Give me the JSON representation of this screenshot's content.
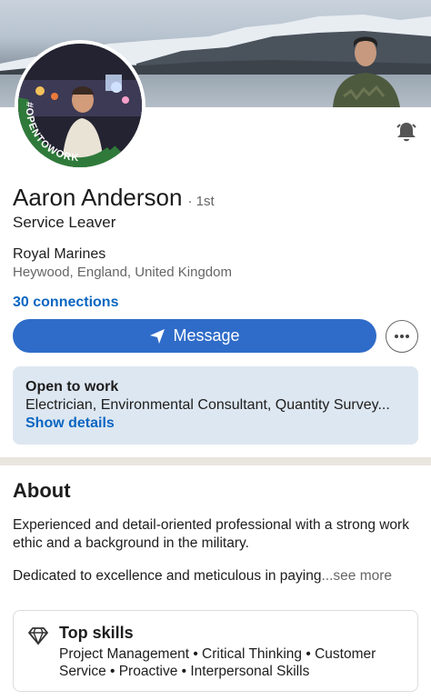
{
  "profile": {
    "badge_text": "#OPENTOWORK",
    "name": "Aaron Anderson",
    "degree": "· 1st",
    "headline": "Service Leaver",
    "company": "Royal Marines",
    "location": "Heywood, England, United Kingdom",
    "connections": "30 connections"
  },
  "actions": {
    "message_label": "Message",
    "more_icon": "more-horizontal-icon",
    "bell_icon": "bell-icon"
  },
  "open_to_work": {
    "title": "Open to work",
    "roles": "Electrician, Environmental Consultant, Quantity Survey...",
    "link": "Show details"
  },
  "about": {
    "title": "About",
    "paragraph1": "Experienced and detail-oriented professional with a strong work ethic and a background in the military.",
    "paragraph2": "Dedicated to excellence and meticulous in paying",
    "see_more": "...see more"
  },
  "top_skills": {
    "title": "Top skills",
    "skills": "Project Management • Critical Thinking • Customer Service • Proactive • Interpersonal Skills"
  },
  "colors": {
    "accent": "#0a66c2",
    "message_button": "#2f6cc9",
    "open_to_work_bg": "#dde7f1",
    "open_to_work_ring": "#2f7a3a"
  }
}
